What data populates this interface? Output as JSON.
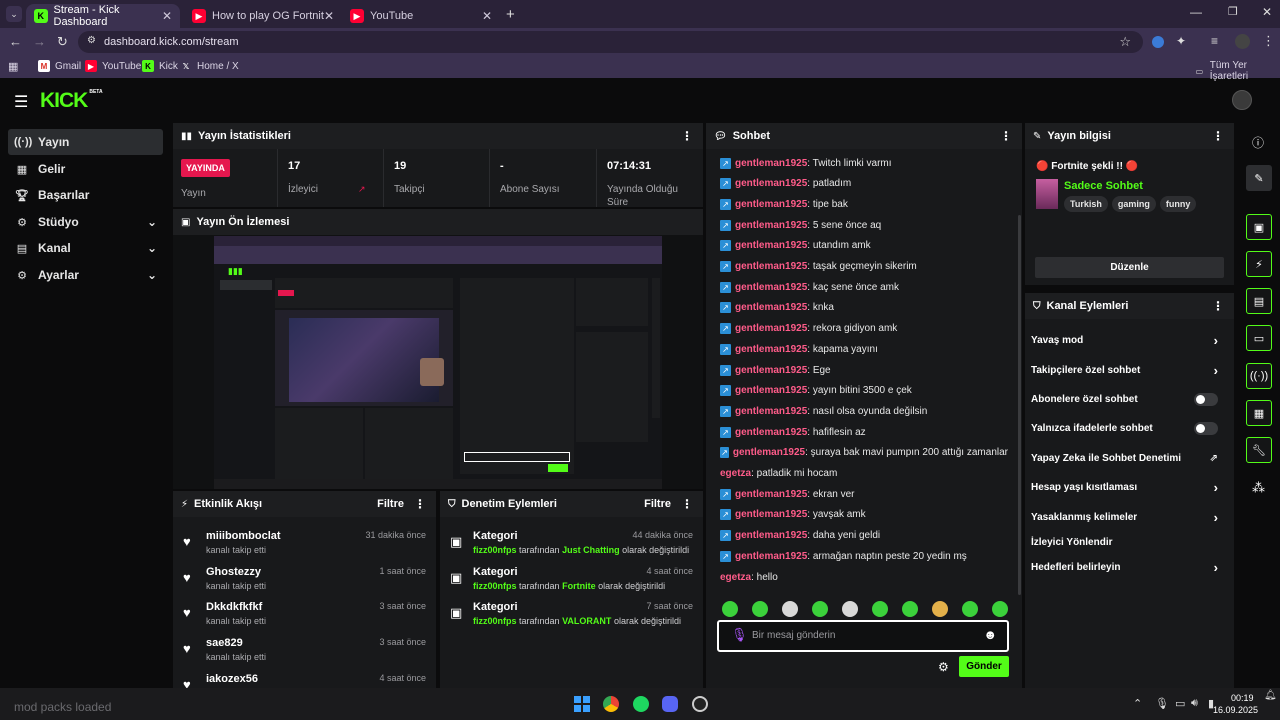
{
  "browser": {
    "tabs": [
      {
        "label": "Stream - Kick Dashboard",
        "active": true
      },
      {
        "label": "How to play OG Fortnite in 202",
        "active": false
      },
      {
        "label": "YouTube",
        "active": false
      }
    ],
    "url": "dashboard.kick.com/stream",
    "bookmarks": [
      "Gmail",
      "YouTube",
      "Kick",
      "Home / X"
    ],
    "all_bookmarks": "Tüm Yer İşaretleri"
  },
  "brand": {
    "logo": "KICK",
    "beta": "BETA",
    "accent": "#53fc18"
  },
  "sidebar": {
    "items": [
      {
        "label": "Yayın",
        "icon": "broadcast-icon",
        "active": true
      },
      {
        "label": "Gelir",
        "icon": "grid-icon"
      },
      {
        "label": "Başarılar",
        "icon": "trophy-icon"
      },
      {
        "label": "Stüdyo",
        "icon": "gear-icon",
        "chevron": true
      },
      {
        "label": "Kanal",
        "icon": "bars-icon",
        "chevron": true
      },
      {
        "label": "Ayarlar",
        "icon": "settings-icon",
        "chevron": true
      }
    ]
  },
  "stats": {
    "title": "Yayın İstatistikleri",
    "live_badge": "YAYINDA",
    "live_label": "Yayın",
    "cells": [
      {
        "value": "17",
        "label": "İzleyici"
      },
      {
        "value": "19",
        "label": "Takipçi"
      },
      {
        "value": "-",
        "label": "Abone Sayısı"
      },
      {
        "value": "07:14:31",
        "label": "Yayında Olduğu Süre"
      }
    ]
  },
  "preview": {
    "title": "Yayın Ön İzlemesi"
  },
  "activity": {
    "title": "Etkinlik Akışı",
    "filter": "Filtre",
    "rows": [
      {
        "name": "miiibomboclat",
        "sub": "kanalı takip etti",
        "time": "31 dakika önce"
      },
      {
        "name": "Ghostezzy",
        "sub": "kanalı takip etti",
        "time": "1 saat önce"
      },
      {
        "name": "Dkkdkfkfkf",
        "sub": "kanalı takip etti",
        "time": "3 saat önce"
      },
      {
        "name": "sae829",
        "sub": "kanalı takip etti",
        "time": "3 saat önce"
      },
      {
        "name": "iakozex56",
        "sub": "",
        "time": "4 saat önce"
      }
    ]
  },
  "moderation": {
    "title": "Denetim Eylemleri",
    "filter": "Filtre",
    "rows": [
      {
        "name": "Kategori",
        "user": "fizz00nfps",
        "mid": "tarafından",
        "cat": "Just Chatting",
        "end": "olarak değiştirildi",
        "time": "44 dakika önce"
      },
      {
        "name": "Kategori",
        "user": "fizz00nfps",
        "mid": "tarafından",
        "cat": "Fortnite",
        "end": "olarak değiştirildi",
        "time": "4 saat önce"
      },
      {
        "name": "Kategori",
        "user": "fizz00nfps",
        "mid": "tarafından",
        "cat": "VALORANT",
        "end": "olarak değiştirildi",
        "time": "7 saat önce"
      }
    ]
  },
  "chat": {
    "title": "Sohbet",
    "messages": [
      {
        "user": "gentleman1925",
        "text": ": Twitch limki varmı",
        "badge": true
      },
      {
        "user": "gentleman1925",
        "text": ": patladım",
        "badge": true
      },
      {
        "user": "gentleman1925",
        "text": ": tipe bak",
        "badge": true
      },
      {
        "user": "gentleman1925",
        "text": ": 5 sene önce aq",
        "badge": true
      },
      {
        "user": "gentleman1925",
        "text": ": utandım amk",
        "badge": true
      },
      {
        "user": "gentleman1925",
        "text": ": taşak geçmeyin sikerim",
        "badge": true
      },
      {
        "user": "gentleman1925",
        "text": ": kaç sene önce amk",
        "badge": true
      },
      {
        "user": "gentleman1925",
        "text": ": knka",
        "badge": true
      },
      {
        "user": "gentleman1925",
        "text": ": rekora gidiyon amk",
        "badge": true
      },
      {
        "user": "gentleman1925",
        "text": ": kapama yayını",
        "badge": true
      },
      {
        "user": "gentleman1925",
        "text": ": Ege",
        "badge": true
      },
      {
        "user": "gentleman1925",
        "text": ": yayın bitini 3500 e çek",
        "badge": true
      },
      {
        "user": "gentleman1925",
        "text": ": nasıl olsa oyunda değilsin",
        "badge": true
      },
      {
        "user": "gentleman1925",
        "text": ": hafiflesin az",
        "badge": true
      },
      {
        "user": "gentleman1925",
        "text": ": şuraya bak mavi pumpın 200 attığı zamanlar",
        "badge": true
      },
      {
        "user": "egetza",
        "text": ": patladik mi hocam",
        "badge": false
      },
      {
        "user": "gentleman1925",
        "text": ": ekran ver",
        "badge": true
      },
      {
        "user": "gentleman1925",
        "text": ": yavşak amk",
        "badge": true
      },
      {
        "user": "gentleman1925",
        "text": ": daha yeni geldi",
        "badge": true
      },
      {
        "user": "gentleman1925",
        "text": ": armağan naptın peste 20 yedin mş",
        "badge": true
      },
      {
        "user": "egetza",
        "text": ": hello",
        "badge": false
      }
    ],
    "placeholder": "Bir mesaj gönderin",
    "send": "Gönder"
  },
  "info": {
    "title": "Yayın bilgisi",
    "stream_title": "🔴 Fortnite şekli !! 🔴",
    "category": "Sadece Sohbet",
    "tags": [
      "Turkish",
      "gaming",
      "funny"
    ],
    "edit": "Düzenle"
  },
  "channel_actions": {
    "title": "Kanal Eylemleri",
    "items": [
      {
        "label": "Yavaş mod",
        "kind": "chevron"
      },
      {
        "label": "Takipçilere özel sohbet",
        "kind": "chevron"
      },
      {
        "label": "Abonelere özel sohbet",
        "kind": "toggle"
      },
      {
        "label": "Yalnızca ifadelerle sohbet",
        "kind": "toggle"
      },
      {
        "label": "Yapay Zeka ile Sohbet Denetimi",
        "kind": "external"
      },
      {
        "label": "Hesap yaşı kısıtlaması",
        "kind": "chevron"
      },
      {
        "label": "Yasaklanmış kelimeler",
        "kind": "chevron"
      },
      {
        "label": "İzleyici Yönlendir",
        "kind": "none"
      },
      {
        "label": "Hedefleri belirleyin",
        "kind": "chevron"
      }
    ]
  },
  "taskbar": {
    "left_text": "mod packs loaded",
    "time": "00:19",
    "date": "16.09.2025"
  }
}
